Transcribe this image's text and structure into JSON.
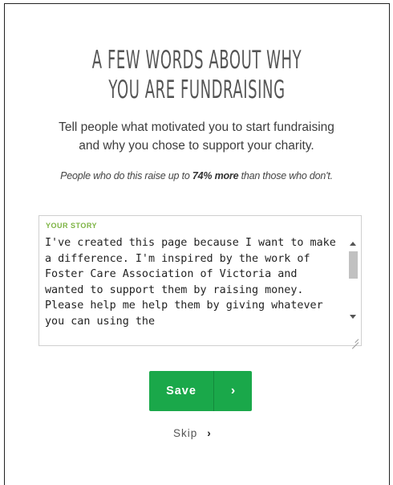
{
  "heading": {
    "line1": "A FEW WORDS ABOUT WHY",
    "line2": "YOU ARE FUNDRAISING"
  },
  "lead": {
    "line1": "Tell people what motivated you to start fundraising",
    "line2": "and why you chose to support your charity."
  },
  "tip": {
    "prefix": "People who do this raise up to",
    "highlight": "74% more",
    "suffix": "than those who don't."
  },
  "story": {
    "label": "YOUR STORY",
    "value": "I've created this page because I want to make a difference. I'm inspired by the work of Foster Care Association of Victoria and wanted to support them by raising money. Please help me help them by giving whatever you can using the"
  },
  "actions": {
    "save_label": "Save",
    "save_icon": "chevron-right-icon",
    "skip_label": "Skip",
    "skip_icon": "chevron-right-icon"
  },
  "colors": {
    "accent_green": "#1aa84a",
    "label_green": "#7cb342"
  }
}
